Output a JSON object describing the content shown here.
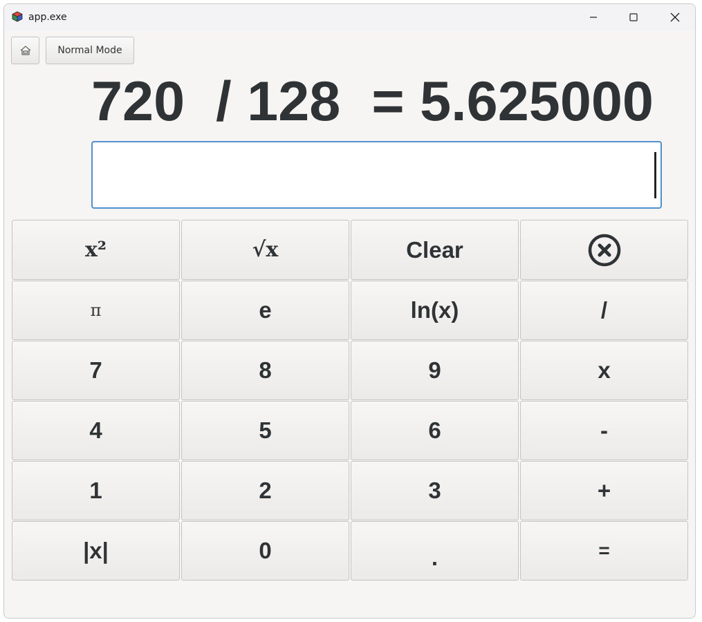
{
  "window": {
    "title": "app.exe",
    "icon": "app-cube-icon"
  },
  "toolbar": {
    "home_icon": "home-icon",
    "mode_label": "Normal Mode"
  },
  "display": {
    "expression": "720  / 128  = 5.625000",
    "input_value": ""
  },
  "keypad": {
    "rows": [
      [
        "x²",
        "√x",
        "Clear",
        "backspace-icon"
      ],
      [
        "π",
        "e",
        "ln(x)",
        "/"
      ],
      [
        "7",
        "8",
        "9",
        "x"
      ],
      [
        "4",
        "5",
        "6",
        "-"
      ],
      [
        "1",
        "2",
        "3",
        "+"
      ],
      [
        "|x|",
        "0",
        ".",
        "="
      ]
    ]
  },
  "colors": {
    "accent": "#4f91cc",
    "text": "#2f3335",
    "background": "#f6f5f4"
  }
}
